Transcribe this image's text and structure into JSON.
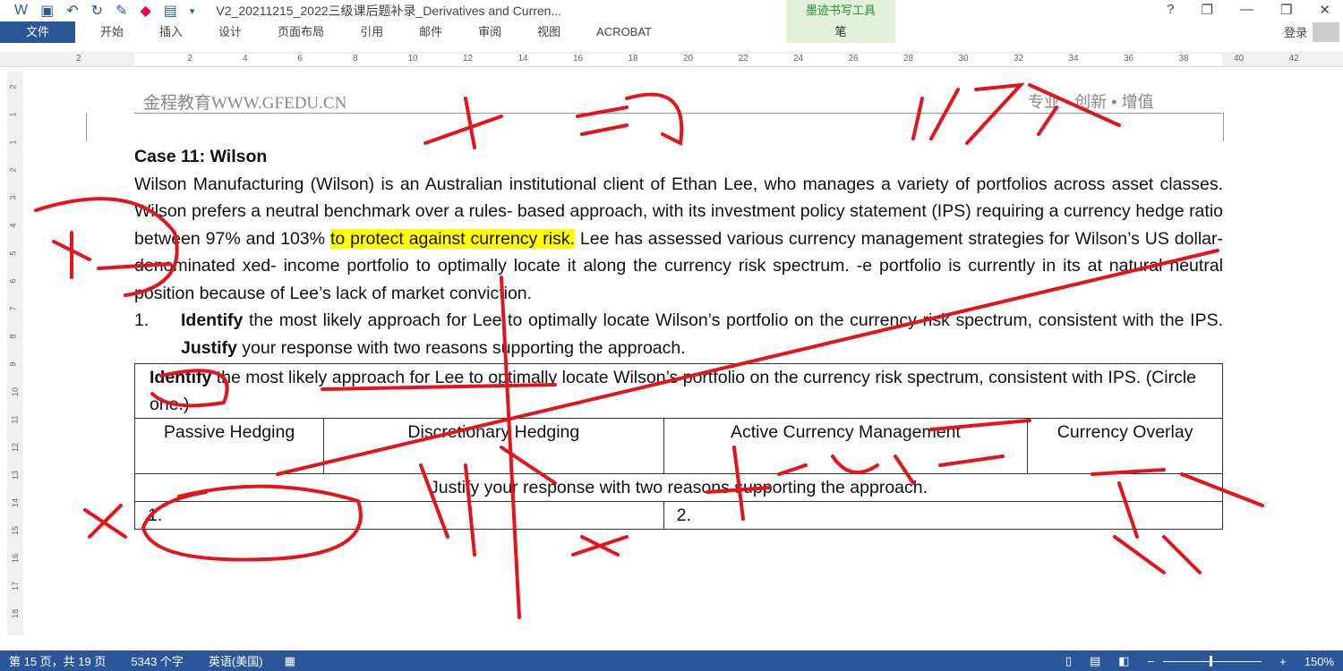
{
  "window": {
    "title": "V2_20211215_2022三级课后题补录_Derivatives and Curren...",
    "ink_tools_label": "墨迹书写工具",
    "ink_tools_tab": "笔",
    "help": "?",
    "minimize": "—",
    "restore": "❐",
    "close": "✕"
  },
  "ribbon": {
    "tabs": [
      "文件",
      "开始",
      "插入",
      "设计",
      "页面布局",
      "引用",
      "邮件",
      "审阅",
      "视图",
      "ACROBAT"
    ],
    "login": "登录"
  },
  "ruler": {
    "marks": [
      "2",
      "2",
      "4",
      "6",
      "8",
      "10",
      "12",
      "14",
      "16",
      "18",
      "20",
      "22",
      "24",
      "26",
      "28",
      "30",
      "32",
      "34",
      "36",
      "38",
      "40",
      "42"
    ],
    "vmarks": [
      "2",
      "1",
      "1",
      "2",
      "3",
      "4",
      "5",
      "6",
      "7",
      "8",
      "9",
      "10",
      "11",
      "12",
      "13",
      "14",
      "15",
      "16",
      "17",
      "18"
    ]
  },
  "page": {
    "header_left": "金程教育WWW.GFEDU.CN",
    "header_right": "专业 • 创新 • 增值",
    "case_title": "Case 11: Wilson",
    "para_a": "Wilson Manufacturing (Wilson) is an Australian institutional client of Ethan Lee, who manages a variety of portfolios across asset classes. Wilson prefers a neutral benchmark over a rules- based approach, with its investment policy statement (IPS) requiring a currency hedge ratio between 97% and 103% ",
    "para_hl": "to protect against currency risk.",
    "para_b": " Lee has assessed various currency management strategies for Wilson’s US dollar- denominated xed- income portfolio to optimally locate it along the currency risk spectrum. -e portfolio is currently in its at natural neutral position because of Lee’s lack of market conviction.",
    "q_num": "1.",
    "q_bold1": "Identify",
    "q_text1": " the most likely approach for Lee to optimally locate Wilson’s portfolio on the currency risk spectrum, consistent with the IPS. ",
    "q_bold2": "Justify",
    "q_text2": " your response with two reasons supporting the approach.",
    "table": {
      "row1_bold": "Identify",
      "row1_text": " the most likely approach for Lee to optimally locate Wilson’s portfolio on the currency risk spectrum, consistent with IPS. (Circle one.)",
      "options": [
        "Passive Hedging",
        "Discretionary Hedging",
        "Active Currency Management",
        "Currency Overlay"
      ],
      "justify": "Justify your response with two reasons supporting the approach.",
      "answers": [
        "1.",
        "2."
      ]
    }
  },
  "status": {
    "page": "第 15 页，共 19 页",
    "words": "5343 个字",
    "language": "英语(美国)",
    "zoom": "150%"
  }
}
